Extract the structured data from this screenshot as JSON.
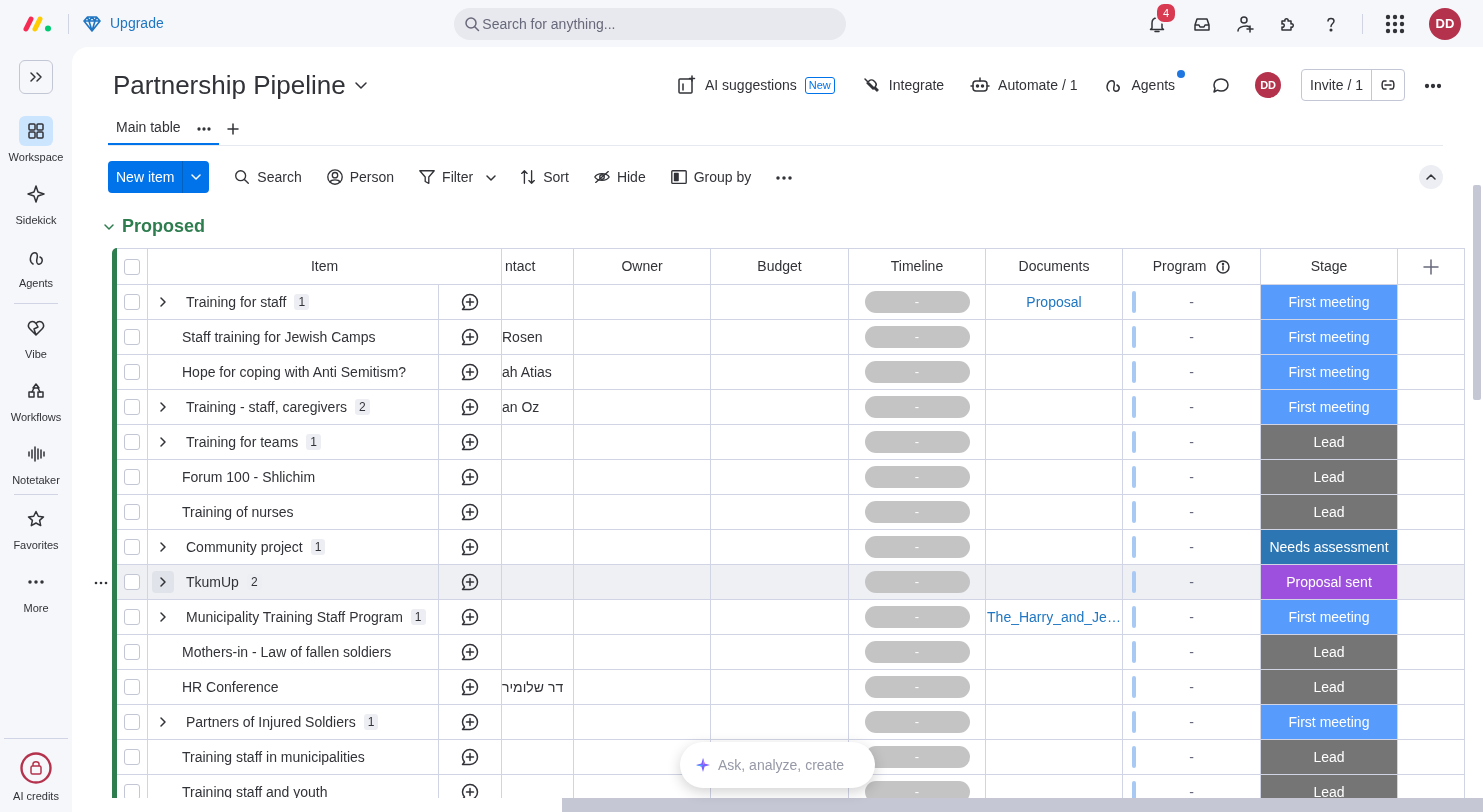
{
  "top_bar": {
    "upgrade": "Upgrade",
    "search": {
      "placeholder": "Search for anything..."
    },
    "notifications": "4",
    "avatar": "DD"
  },
  "sidebar": {
    "items": [
      {
        "label": "Workspace",
        "kind": "grid",
        "selected": true
      },
      {
        "label": "Sidekick",
        "kind": "sparkle",
        "selected": false
      },
      {
        "label": "Agents",
        "kind": "agents",
        "selected": false
      },
      {
        "label": "Vibe",
        "kind": "heart",
        "selected": false
      },
      {
        "label": "Workflows",
        "kind": "shapes",
        "selected": false
      },
      {
        "label": "Notetaker",
        "kind": "wave",
        "selected": false
      },
      {
        "label": "Favorites",
        "kind": "star",
        "selected": false
      },
      {
        "label": "More",
        "kind": "dots",
        "selected": false
      }
    ],
    "footer": {
      "label": "AI credits"
    }
  },
  "board": {
    "title": "Partnership Pipeline",
    "actions": [
      {
        "label": "AI suggestions",
        "kind": "ai",
        "badge": "New",
        "dot": false
      },
      {
        "label": "Integrate",
        "kind": "integrate",
        "dot": false
      },
      {
        "label": "Automate / 1",
        "kind": "robot",
        "dot": false
      },
      {
        "label": "Agents",
        "kind": "agents",
        "dot": true
      }
    ],
    "avatar": "DD",
    "invite": "Invite / 1"
  },
  "tabs": [
    {
      "label": "Main table",
      "selected": true
    }
  ],
  "toolbar": {
    "new_item": "New item",
    "tools": [
      {
        "label": "Search",
        "kind": "search"
      },
      {
        "label": "Person",
        "kind": "person"
      },
      {
        "label": "Filter",
        "kind": "filter"
      },
      {
        "label": "Sort",
        "kind": "sort"
      },
      {
        "label": "Hide",
        "kind": "hide"
      },
      {
        "label": "Group by",
        "kind": "group"
      }
    ]
  },
  "group": {
    "title": "Proposed",
    "color": "#2e7d4f",
    "expanded": true
  },
  "table": {
    "all_checked": false,
    "columns": [
      {
        "label": "Item",
        "info": false
      },
      {
        "label": "ntact",
        "info": false
      },
      {
        "label": "Owner",
        "info": false
      },
      {
        "label": "Budget",
        "info": false
      },
      {
        "label": "Timeline",
        "info": false
      },
      {
        "label": "Documents",
        "info": false
      },
      {
        "label": "Program",
        "info": true
      },
      {
        "label": "Stage",
        "info": false
      }
    ],
    "rows": [
      {
        "item": {
          "name": "Training for staff",
          "subitems": "1"
        },
        "checked": false,
        "highlighted": false,
        "timeline": "-",
        "document": "Proposal",
        "program": "-",
        "stage": {
          "label": "First meeting",
          "color": "#579bfc"
        }
      },
      {
        "item": {
          "name": "Staff training for Jewish Camps"
        },
        "checked": false,
        "highlighted": false,
        "contact": "Rosen",
        "timeline": "-",
        "program": "-",
        "stage": {
          "label": "First meeting",
          "color": "#579bfc"
        }
      },
      {
        "item": {
          "name": "Hope for coping with Anti Semitism?"
        },
        "checked": false,
        "highlighted": false,
        "contact": "ah Atias",
        "timeline": "-",
        "program": "-",
        "stage": {
          "label": "First meeting",
          "color": "#579bfc"
        }
      },
      {
        "item": {
          "name": "Training - staff, caregivers",
          "subitems": "2"
        },
        "checked": false,
        "highlighted": false,
        "contact": "an Oz",
        "timeline": "-",
        "program": "-",
        "stage": {
          "label": "First meeting",
          "color": "#579bfc"
        }
      },
      {
        "item": {
          "name": "Training for teams",
          "subitems": "1"
        },
        "checked": false,
        "highlighted": false,
        "timeline": "-",
        "program": "-",
        "stage": {
          "label": "Lead",
          "color": "#757575"
        }
      },
      {
        "item": {
          "name": "Forum 100 - Shlichim"
        },
        "checked": false,
        "highlighted": false,
        "timeline": "-",
        "program": "-",
        "stage": {
          "label": "Lead",
          "color": "#757575"
        }
      },
      {
        "item": {
          "name": "Training of nurses"
        },
        "checked": false,
        "highlighted": false,
        "timeline": "-",
        "program": "-",
        "stage": {
          "label": "Lead",
          "color": "#757575"
        }
      },
      {
        "item": {
          "name": "Community project",
          "subitems": "1"
        },
        "checked": false,
        "highlighted": false,
        "timeline": "-",
        "program": "-",
        "stage": {
          "label": "Needs assessment",
          "color": "#2c76b4"
        }
      },
      {
        "item": {
          "name": "TkumUp",
          "subitems": "2"
        },
        "checked": false,
        "highlighted": true,
        "timeline": "-",
        "program": "-",
        "stage": {
          "label": "Proposal sent",
          "color": "#9d50dd"
        }
      },
      {
        "item": {
          "name": "Municipality Training Staff Program",
          "subitems": "1"
        },
        "checked": false,
        "highlighted": false,
        "timeline": "-",
        "document": "The_Harry_and_Je…",
        "program": "-",
        "stage": {
          "label": "First meeting",
          "color": "#579bfc"
        }
      },
      {
        "item": {
          "name": "Mothers-in - Law of fallen soldiers"
        },
        "checked": false,
        "highlighted": false,
        "timeline": "-",
        "program": "-",
        "stage": {
          "label": "Lead",
          "color": "#757575"
        }
      },
      {
        "item": {
          "name": "HR Conference"
        },
        "checked": false,
        "highlighted": false,
        "contact": "דר שלומיר",
        "timeline": "-",
        "program": "-",
        "stage": {
          "label": "Lead",
          "color": "#757575"
        }
      },
      {
        "item": {
          "name": "Partners of Injured Soldiers",
          "subitems": "1"
        },
        "checked": false,
        "highlighted": false,
        "timeline": "-",
        "program": "-",
        "stage": {
          "label": "First meeting",
          "color": "#579bfc"
        }
      },
      {
        "item": {
          "name": "Training staff in municipalities"
        },
        "checked": false,
        "highlighted": false,
        "timeline": "-",
        "program": "-",
        "stage": {
          "label": "Lead",
          "color": "#757575"
        }
      },
      {
        "item": {
          "name": "Training staff and youth"
        },
        "checked": false,
        "highlighted": false,
        "timeline": "-",
        "program": "-",
        "stage": {
          "label": "Lead",
          "color": "#757575"
        }
      }
    ]
  },
  "assistant": {
    "placeholder": "Ask, analyze, create"
  }
}
